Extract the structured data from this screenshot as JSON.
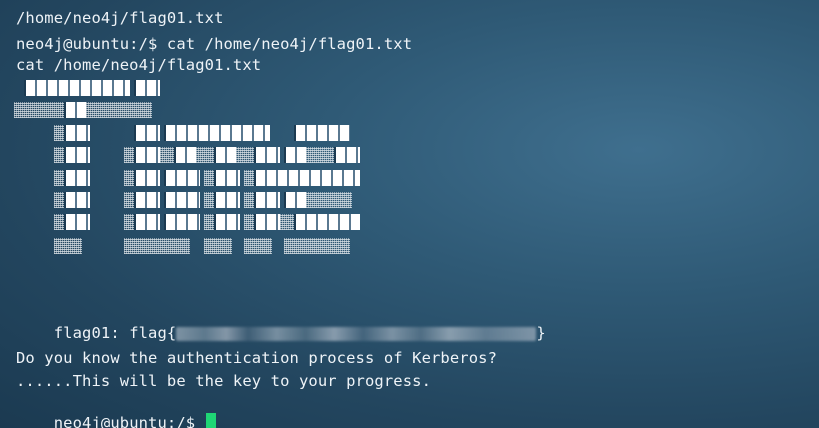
{
  "terminal": {
    "lines": [
      "/home/neo4j/flag01.txt",
      "neo4j@ubuntu:/$ cat /home/neo4j/flag01.txt",
      "cat /home/neo4j/flag01.txt"
    ],
    "flag": {
      "prefix": "flag01: flag{",
      "suffix": "}"
    },
    "message_1": "Do you know the authentication process of Kerberos?",
    "message_2": "......This will be the key to your progress.",
    "prompt": "neo4j@ubuntu:/$ "
  },
  "colors": {
    "background": "#23465f",
    "text": "#eef3f7",
    "cursor": "#1fd675"
  }
}
